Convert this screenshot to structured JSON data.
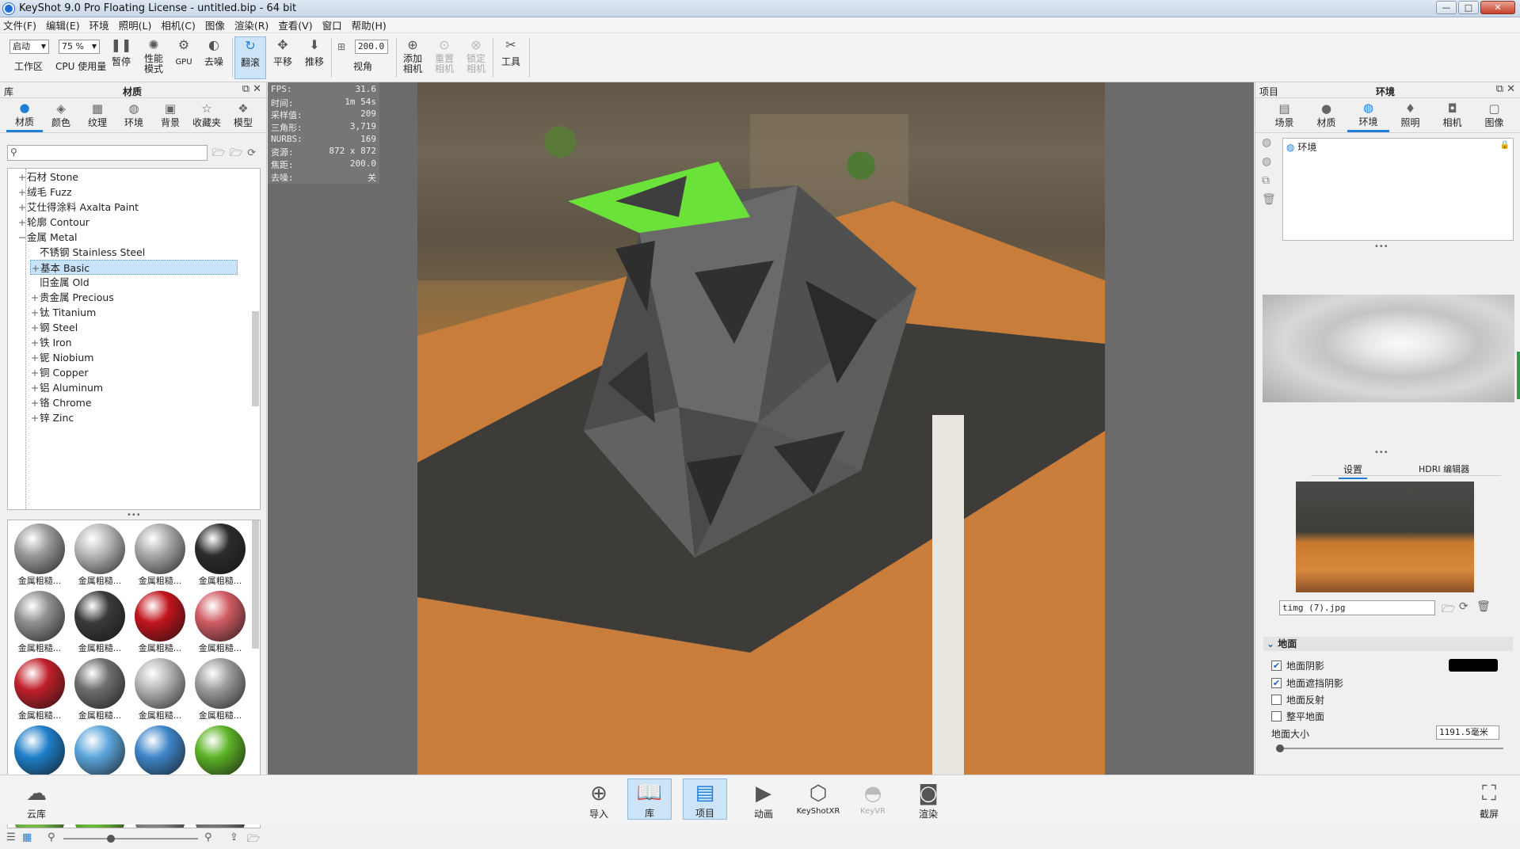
{
  "window": {
    "title": "KeyShot 9.0 Pro Floating License  - untitled.bip  - 64 bit",
    "controls": [
      "—",
      "□",
      "✕"
    ]
  },
  "menu": [
    "文件(F)",
    "编辑(E)",
    "环境",
    "照明(L)",
    "相机(C)",
    "图像",
    "渲染(R)",
    "查看(V)",
    "窗口",
    "帮助(H)"
  ],
  "toolbar": {
    "workspace_select": "启动",
    "workspace_label": "工作区",
    "cpu_select": "75 %",
    "cpu_label": "CPU 使用量",
    "pause": "暂停",
    "perf_mode": "性能\n模式",
    "gpu": "GPU",
    "denoise": "去噪",
    "tumble": "翻滚",
    "pan": "平移",
    "dolly": "推移",
    "fov_value": "200.0",
    "fov_label": "视角",
    "add_camera": "添加\n相机",
    "reset_camera": "重置\n相机",
    "lock_camera": "锁定\n相机",
    "tools": "工具"
  },
  "left_panel": {
    "header_left": "库",
    "header_title": "材质",
    "tabs": [
      "材质",
      "颜色",
      "纹理",
      "环境",
      "背景",
      "收藏夹",
      "模型"
    ],
    "search_placeholder": "",
    "tree": [
      {
        "pm": "+",
        "label": "石材 Stone",
        "indent": 1
      },
      {
        "pm": "+",
        "label": "绒毛 Fuzz",
        "indent": 1
      },
      {
        "pm": "+",
        "label": "艾仕得涂料 Axalta Paint",
        "indent": 1
      },
      {
        "pm": "+",
        "label": "轮廓 Contour",
        "indent": 1
      },
      {
        "pm": "−",
        "label": "金属 Metal",
        "indent": 1
      },
      {
        "pm": "",
        "label": "不锈钢 Stainless Steel",
        "indent": 2
      },
      {
        "pm": "+",
        "label": "基本 Basic",
        "indent": 2,
        "selected": true
      },
      {
        "pm": "",
        "label": "旧金属 Old",
        "indent": 2
      },
      {
        "pm": "+",
        "label": "贵金属 Precious",
        "indent": 2
      },
      {
        "pm": "+",
        "label": "钛 Titanium",
        "indent": 2
      },
      {
        "pm": "+",
        "label": "钢 Steel",
        "indent": 2
      },
      {
        "pm": "+",
        "label": "铁 Iron",
        "indent": 2
      },
      {
        "pm": "+",
        "label": "铌 Niobium",
        "indent": 2
      },
      {
        "pm": "+",
        "label": "铜 Copper",
        "indent": 2
      },
      {
        "pm": "+",
        "label": "铝 Aluminum",
        "indent": 2
      },
      {
        "pm": "+",
        "label": "铬 Chrome",
        "indent": 2
      },
      {
        "pm": "+",
        "label": "锌 Zinc",
        "indent": 2
      }
    ],
    "thumb_label": "金属粗糙...",
    "thumb_colors": [
      "#9a9a9a",
      "#b8b8b8",
      "#a9a9a9",
      "#2c2c2c",
      "#8f8f8f",
      "#3a3a3a",
      "#c0141c",
      "#d05b63",
      "#c0202a",
      "#6e6e6e",
      "#b5b5b5",
      "#9c9c9c",
      "#1f7fc9",
      "#5ca6dc",
      "#3f86c9",
      "#5cb327",
      "#7bc24a",
      "#6cc03a",
      "#8a8a8a",
      "#7a7a7a"
    ]
  },
  "viewport": {
    "stats": [
      [
        "FPS:",
        "31.6"
      ],
      [
        "时间:",
        "1m 54s"
      ],
      [
        "采样值:",
        "209"
      ],
      [
        "三角形:",
        "3,719"
      ],
      [
        "NURBS:",
        "169"
      ],
      [
        "资源:",
        "872 x 872"
      ],
      [
        "焦距:",
        "200.0"
      ],
      [
        "去噪:",
        "关"
      ]
    ]
  },
  "right_panel": {
    "header_left": "项目",
    "header_title": "环境",
    "tabs": [
      "场景",
      "材质",
      "环境",
      "照明",
      "相机",
      "图像"
    ],
    "env_item": "环境",
    "subtabs": [
      "设置",
      "HDRI 编辑器"
    ],
    "background_file": "timg (7).jpg",
    "ground_section": "地面",
    "ground_options": [
      {
        "label": "地面阴影",
        "checked": true
      },
      {
        "label": "地面遮挡阴影",
        "checked": true
      },
      {
        "label": "地面反射",
        "checked": false
      },
      {
        "label": "整平地面",
        "checked": false
      }
    ],
    "ground_size_label": "地面大小",
    "ground_size_value": "1191.5毫米"
  },
  "bottom": {
    "cloud": "云库",
    "import": "导入",
    "library": "库",
    "project": "项目",
    "animation": "动画",
    "keyshotxr": "KeyShotXR",
    "keyvr": "KeyVR",
    "render": "渲染",
    "screenshot": "截屏"
  }
}
